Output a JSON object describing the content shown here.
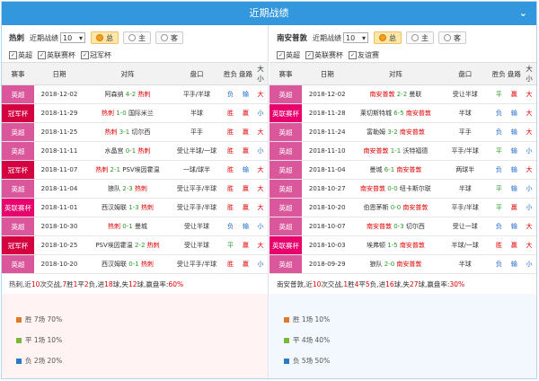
{
  "header": {
    "title": "近期战绩",
    "collapse_icon": "chevron-down-icon"
  },
  "colors": {
    "epl": "#d9579a",
    "cup": "#d5003f",
    "fa": "#e8006d",
    "win": "#e00000",
    "draw": "#2a9a2a",
    "loss": "#1a68c9",
    "header": "#3397dd"
  },
  "columns": [
    "赛事",
    "日期",
    "对阵",
    "盘口",
    "胜负",
    "盘路",
    "大小"
  ],
  "left": {
    "team": "热刺",
    "recent_label": "近期战绩",
    "count": "10",
    "filters": [
      "总",
      "主",
      "客"
    ],
    "selected_filter": "总",
    "checks": [
      "英超",
      "英联赛杯",
      "冠军杯"
    ],
    "rows": [
      {
        "league": "英超",
        "lc": "epl",
        "date": "2018-12-02",
        "home": "阿森纳",
        "hs": "",
        "score": "4-2",
        "away": "热刺",
        "as": "r",
        "hc": "平手/半球",
        "r": "负",
        "rc": "blu",
        "p": "输",
        "pc": "blu",
        "ou": "大",
        "oc": "red"
      },
      {
        "league": "冠军杯",
        "lc": "cup",
        "date": "2018-11-29",
        "home": "热刺",
        "hs": "r",
        "score": "1-0",
        "away": "国际米兰",
        "as": "",
        "hc": "半球",
        "r": "胜",
        "rc": "red",
        "p": "赢",
        "pc": "red",
        "ou": "小",
        "oc": "blu"
      },
      {
        "league": "英超",
        "lc": "epl",
        "date": "2018-11-25",
        "home": "热刺",
        "hs": "r",
        "score": "3-1",
        "away": "切尔西",
        "as": "",
        "hc": "平手",
        "r": "胜",
        "rc": "red",
        "p": "赢",
        "pc": "red",
        "ou": "大",
        "oc": "red"
      },
      {
        "league": "英超",
        "lc": "epl",
        "date": "2018-11-11",
        "home": "水晶宫",
        "hs": "",
        "score": "0-1",
        "away": "热刺",
        "as": "r",
        "hc": "受让半球/一球",
        "r": "胜",
        "rc": "red",
        "p": "赢",
        "pc": "red",
        "ou": "小",
        "oc": "blu"
      },
      {
        "league": "冠军杯",
        "lc": "cup",
        "date": "2018-11-07",
        "home": "热刺",
        "hs": "r",
        "score": "2-1",
        "away": "PSV埃因霍温",
        "as": "",
        "hc": "一球/球半",
        "r": "胜",
        "rc": "red",
        "p": "输",
        "pc": "blu",
        "ou": "大",
        "oc": "red"
      },
      {
        "league": "英超",
        "lc": "epl",
        "date": "2018-11-04",
        "home": "狼队",
        "hs": "",
        "score": "2-3",
        "away": "热刺",
        "as": "r",
        "hc": "受让平手/半球",
        "r": "胜",
        "rc": "red",
        "p": "赢",
        "pc": "red",
        "ou": "大",
        "oc": "red"
      },
      {
        "league": "英联赛杯",
        "lc": "fa",
        "date": "2018-11-01",
        "home": "西汉姆联",
        "hs": "",
        "score": "1-3",
        "away": "热刺",
        "as": "r",
        "hc": "受让平手/半球",
        "r": "胜",
        "rc": "red",
        "p": "赢",
        "pc": "red",
        "ou": "大",
        "oc": "red"
      },
      {
        "league": "英超",
        "lc": "epl",
        "date": "2018-10-30",
        "home": "热刺",
        "hs": "r",
        "score": "0-1",
        "away": "曼城",
        "as": "",
        "hc": "受让半球",
        "r": "负",
        "rc": "blu",
        "p": "输",
        "pc": "blu",
        "ou": "小",
        "oc": "blu"
      },
      {
        "league": "冠军杯",
        "lc": "cup",
        "date": "2018-10-25",
        "home": "PSV埃因霍温",
        "hs": "",
        "score": "2-2",
        "away": "热刺",
        "as": "r",
        "hc": "受让半球",
        "r": "平",
        "rc": "grn",
        "p": "赢",
        "pc": "red",
        "ou": "大",
        "oc": "red"
      },
      {
        "league": "英超",
        "lc": "epl",
        "date": "2018-10-20",
        "home": "西汉姆联",
        "hs": "",
        "score": "0-1",
        "away": "热刺",
        "as": "r",
        "hc": "受让平手/半球",
        "r": "胜",
        "rc": "red",
        "p": "赢",
        "pc": "red",
        "ou": "小",
        "oc": "blu"
      }
    ],
    "summary": {
      "team": "热刺",
      "p1": ",近",
      "n": "10",
      "p2": "次交战,",
      "w": "7",
      "p3": "胜",
      "d": "1",
      "p4": "平",
      "l": "2",
      "p5": "负,进",
      "gf": "18",
      "p6": "球,失",
      "ga": "12",
      "p7": "球,赢盘率:",
      "rate": "60%"
    },
    "stats": [
      {
        "text": "胜 7场 70%",
        "color": "#e07a2a"
      },
      {
        "text": "平 1场 10%",
        "color": "#7ab83a"
      },
      {
        "text": "负 2场 20%",
        "color": "#2a7ac8"
      }
    ]
  },
  "right": {
    "team": "南安普敦",
    "recent_label": "近期战绩",
    "count": "10",
    "filters": [
      "总",
      "主",
      "客"
    ],
    "selected_filter": "总",
    "checks": [
      "英超",
      "英联赛杯",
      "友谊赛"
    ],
    "rows": [
      {
        "league": "英超",
        "lc": "epl",
        "date": "2018-12-02",
        "home": "南安普敦",
        "hs": "r",
        "score": "2-2",
        "away": "曼联",
        "as": "",
        "hc": "受让半球",
        "r": "平",
        "rc": "grn",
        "p": "赢",
        "pc": "red",
        "ou": "大",
        "oc": "red"
      },
      {
        "league": "英联赛杯",
        "lc": "fa",
        "date": "2018-11-28",
        "home": "莱切斯特城",
        "hs": "",
        "score": "6-5",
        "away": "南安普敦",
        "as": "r",
        "hc": "半球",
        "r": "负",
        "rc": "blu",
        "p": "输",
        "pc": "blu",
        "ou": "大",
        "oc": "red"
      },
      {
        "league": "英超",
        "lc": "epl",
        "date": "2018-11-24",
        "home": "富勒姆",
        "hs": "",
        "score": "3-2",
        "away": "南安普敦",
        "as": "r",
        "hc": "平手",
        "r": "负",
        "rc": "blu",
        "p": "输",
        "pc": "blu",
        "ou": "大",
        "oc": "red"
      },
      {
        "league": "英超",
        "lc": "epl",
        "date": "2018-11-10",
        "home": "南安普敦",
        "hs": "r",
        "score": "1-1",
        "away": "沃特福德",
        "as": "",
        "hc": "平手/半球",
        "r": "平",
        "rc": "grn",
        "p": "输",
        "pc": "blu",
        "ou": "小",
        "oc": "blu"
      },
      {
        "league": "英超",
        "lc": "epl",
        "date": "2018-11-04",
        "home": "曼城",
        "hs": "",
        "score": "6-1",
        "away": "南安普敦",
        "as": "r",
        "hc": "两球半",
        "r": "负",
        "rc": "blu",
        "p": "输",
        "pc": "blu",
        "ou": "大",
        "oc": "red"
      },
      {
        "league": "英超",
        "lc": "epl",
        "date": "2018-10-27",
        "home": "南安普敦",
        "hs": "r",
        "score": "0-0",
        "away": "纽卡斯尔联",
        "as": "",
        "hc": "半球",
        "r": "平",
        "rc": "grn",
        "p": "输",
        "pc": "blu",
        "ou": "小",
        "oc": "blu"
      },
      {
        "league": "英超",
        "lc": "epl",
        "date": "2018-10-20",
        "home": "伯恩茅斯",
        "hs": "",
        "score": "0-0",
        "away": "南安普敦",
        "as": "r",
        "hc": "平手/半球",
        "r": "平",
        "rc": "grn",
        "p": "赢",
        "pc": "red",
        "ou": "小",
        "oc": "blu"
      },
      {
        "league": "英超",
        "lc": "epl",
        "date": "2018-10-07",
        "home": "南安普敦",
        "hs": "r",
        "score": "0-3",
        "away": "切尔西",
        "as": "",
        "hc": "受让一球",
        "r": "负",
        "rc": "blu",
        "p": "输",
        "pc": "blu",
        "ou": "大",
        "oc": "red"
      },
      {
        "league": "英联赛杯",
        "lc": "fa",
        "date": "2018-10-03",
        "home": "埃弗顿",
        "hs": "",
        "score": "1-5",
        "away": "南安普敦",
        "as": "r",
        "hc": "半球/一球",
        "r": "胜",
        "rc": "red",
        "p": "赢",
        "pc": "red",
        "ou": "大",
        "oc": "red"
      },
      {
        "league": "英超",
        "lc": "epl",
        "date": "2018-09-29",
        "home": "狼队",
        "hs": "",
        "score": "2-0",
        "away": "南安普敦",
        "as": "r",
        "hc": "半球",
        "r": "负",
        "rc": "blu",
        "p": "输",
        "pc": "blu",
        "ou": "小",
        "oc": "blu"
      }
    ],
    "summary": {
      "team": "南安普敦",
      "p1": ",近",
      "n": "10",
      "p2": "次交战,",
      "w": "1",
      "p3": "胜",
      "d": "4",
      "p4": "平",
      "l": "5",
      "p5": "负,进",
      "gf": "16",
      "p6": "球,失",
      "ga": "27",
      "p7": "球,赢盘率:",
      "rate": "30%"
    },
    "stats": [
      {
        "text": "胜 1场 10%",
        "color": "#e07a2a"
      },
      {
        "text": "平 4场 40%",
        "color": "#7ab83a"
      },
      {
        "text": "负 5场 50%",
        "color": "#2a7ac8"
      }
    ]
  }
}
